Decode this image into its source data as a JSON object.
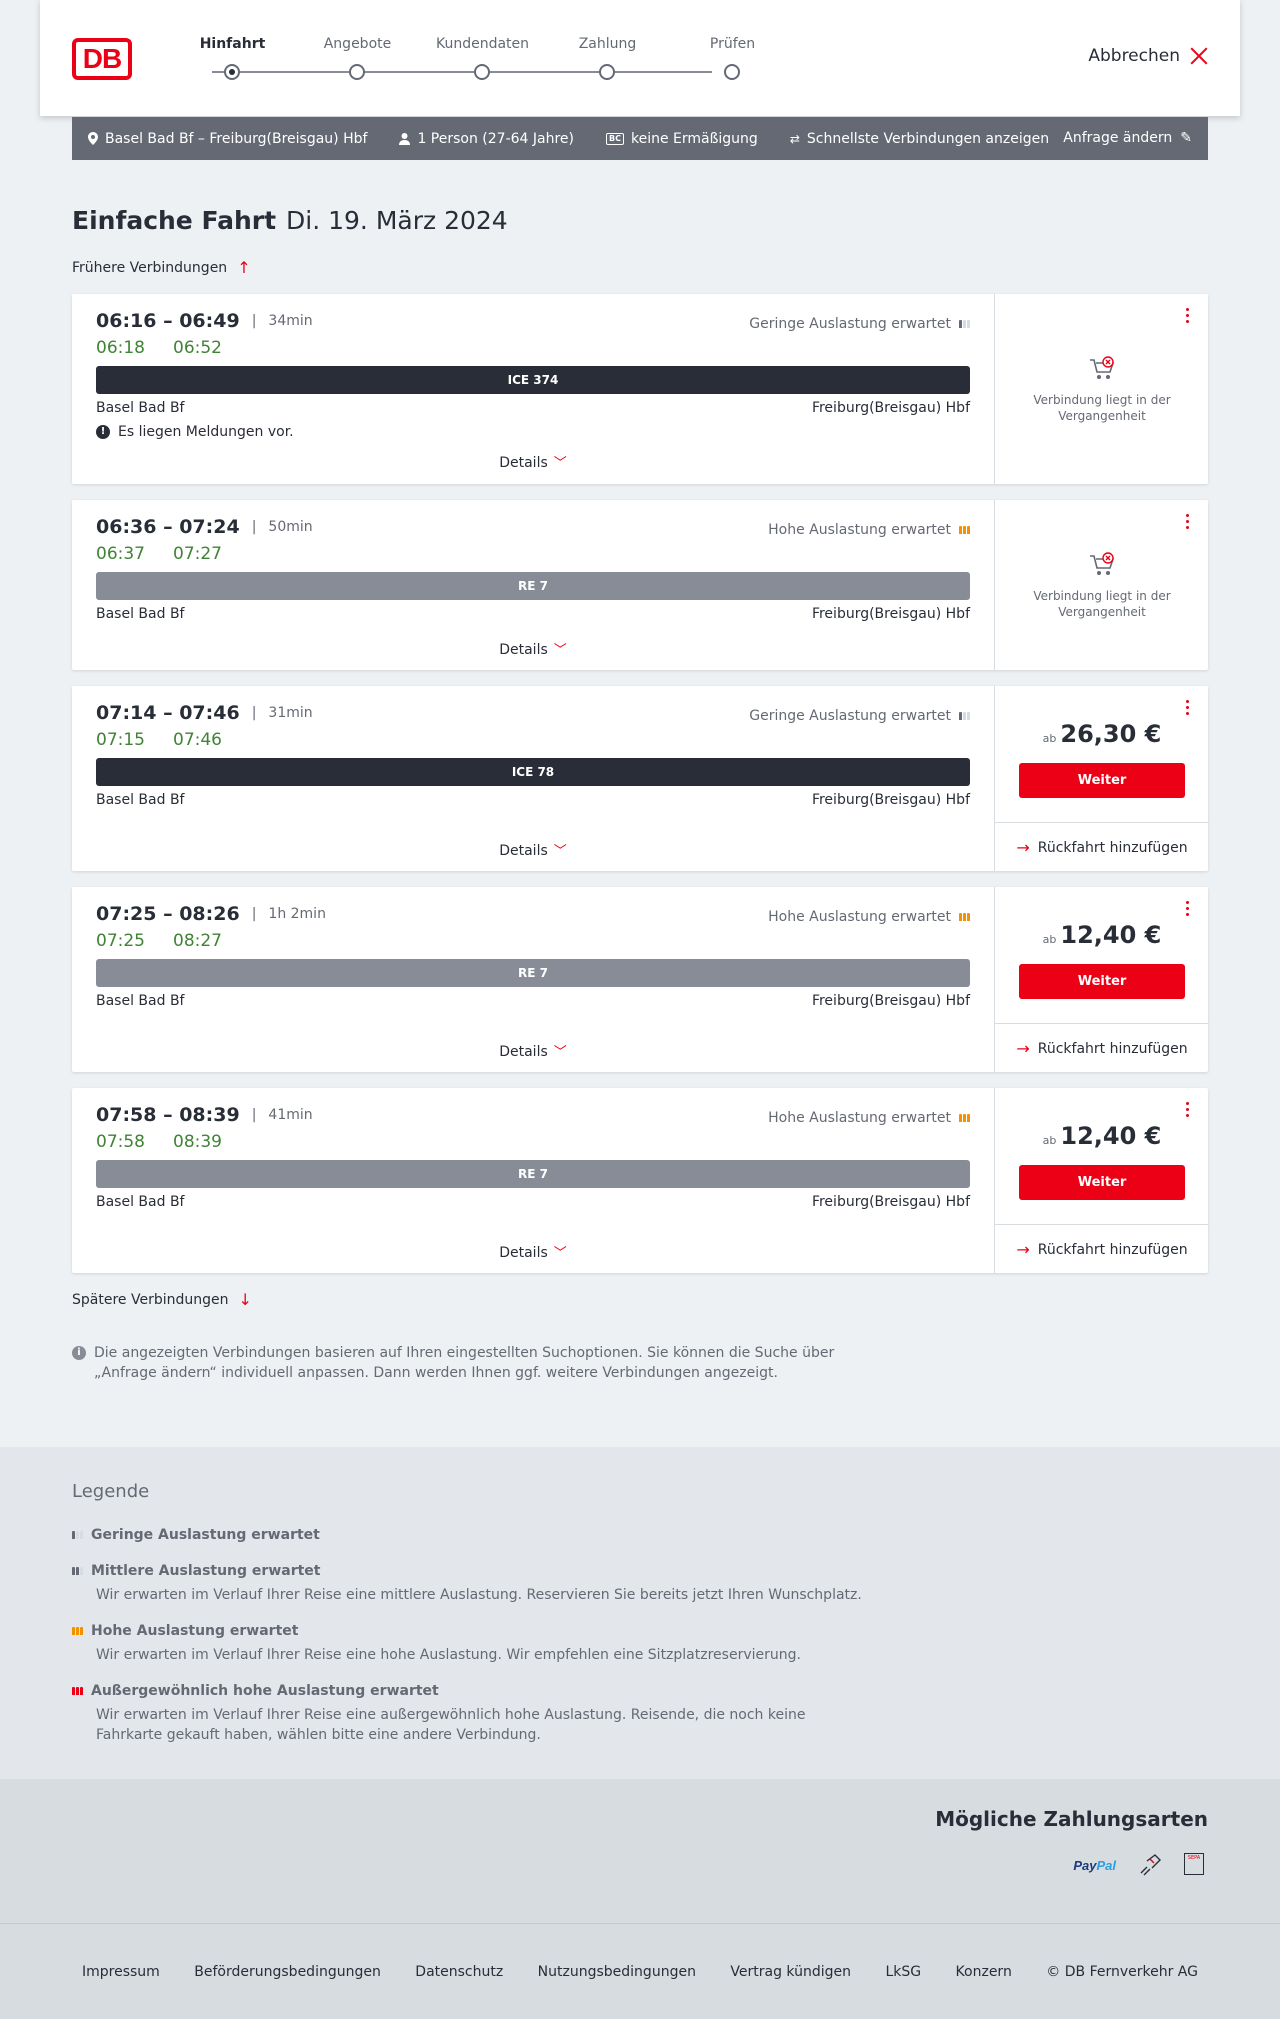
{
  "header": {
    "logo": "DB",
    "steps": [
      {
        "label": "Hinfahrt",
        "active": true
      },
      {
        "label": "Angebote",
        "active": false
      },
      {
        "label": "Kundendaten",
        "active": false
      },
      {
        "label": "Zahlung",
        "active": false
      },
      {
        "label": "Prüfen",
        "active": false
      }
    ],
    "cancel_label": "Abbrechen"
  },
  "query": {
    "route": "Basel Bad Bf – Freiburg(Breisgau) Hbf",
    "persons": "1 Person (27-64 Jahre)",
    "discount_badge": "BC",
    "discount": "keine Ermäßigung",
    "fastest": "Schnellste Verbindungen anzeigen",
    "change": "Anfrage ändern"
  },
  "page": {
    "title": "Einfache Fahrt",
    "date": "Di. 19. März 2024",
    "earlier": "Frühere Verbindungen",
    "later": "Spätere Verbindungen",
    "details_label": "Details",
    "info": "Die angezeigten Verbindungen basieren auf Ihren eingestellten Suchoptionen. Sie können die Suche über „Anfrage ändern“ individuell anpassen. Dann werden Ihnen ggf. weitere Verbindungen angezeigt."
  },
  "connections": [
    {
      "time": "06:16 – 06:49",
      "duration": "34min",
      "rt_dep": "06:18",
      "rt_arr": "06:52",
      "load": "Geringe Auslastung erwartet",
      "load_level": "low",
      "train": "ICE 374",
      "train_type": "ice",
      "from": "Basel Bad Bf",
      "to": "Freiburg(Breisgau) Hbf",
      "message": "Es liegen Meldungen vor.",
      "status": "Verbindung liegt in der Vergangenheit"
    },
    {
      "time": "06:36 – 07:24",
      "duration": "50min",
      "rt_dep": "06:37",
      "rt_arr": "07:27",
      "load": "Hohe Auslastung erwartet",
      "load_level": "high",
      "train": "RE 7",
      "train_type": "re",
      "from": "Basel Bad Bf",
      "to": "Freiburg(Breisgau) Hbf",
      "status": "Verbindung liegt in der Vergangenheit"
    },
    {
      "time": "07:14 – 07:46",
      "duration": "31min",
      "rt_dep": "07:15",
      "rt_arr": "07:46",
      "load": "Geringe Auslastung erwartet",
      "load_level": "low",
      "train": "ICE 78",
      "train_type": "ice",
      "from": "Basel Bad Bf",
      "to": "Freiburg(Breisgau) Hbf",
      "price_prefix": "ab",
      "price": "26,30 €",
      "button": "Weiter",
      "return": "Rückfahrt hinzufügen"
    },
    {
      "time": "07:25 – 08:26",
      "duration": "1h 2min",
      "rt_dep": "07:25",
      "rt_arr": "08:27",
      "load": "Hohe Auslastung erwartet",
      "load_level": "high",
      "train": "RE 7",
      "train_type": "re",
      "from": "Basel Bad Bf",
      "to": "Freiburg(Breisgau) Hbf",
      "price_prefix": "ab",
      "price": "12,40 €",
      "button": "Weiter",
      "return": "Rückfahrt hinzufügen"
    },
    {
      "time": "07:58 – 08:39",
      "duration": "41min",
      "rt_dep": "07:58",
      "rt_arr": "08:39",
      "load": "Hohe Auslastung erwartet",
      "load_level": "high",
      "train": "RE 7",
      "train_type": "re",
      "from": "Basel Bad Bf",
      "to": "Freiburg(Breisgau) Hbf",
      "price_prefix": "ab",
      "price": "12,40 €",
      "button": "Weiter",
      "return": "Rückfahrt hinzufügen"
    }
  ],
  "legend": {
    "title": "Legende",
    "items": [
      {
        "title": "Geringe Auslastung erwartet",
        "text": ""
      },
      {
        "title": "Mittlere Auslastung erwartet",
        "text": "Wir erwarten im Verlauf Ihrer Reise eine mittlere Auslastung. Reservieren Sie bereits jetzt Ihren Wunschplatz."
      },
      {
        "title": "Hohe Auslastung erwartet",
        "text": "Wir erwarten im Verlauf Ihrer Reise eine hohe Auslastung. Wir empfehlen eine Sitzplatzreservierung."
      },
      {
        "title": "Außergewöhnlich hohe Auslastung erwartet",
        "text": "Wir erwarten im Verlauf Ihrer Reise eine außergewöhnlich hohe Auslastung. Reisende, die noch keine Fahrkarte gekauft haben, wählen bitte eine andere Verbindung."
      }
    ]
  },
  "payment": {
    "title": "Mögliche Zahlungsarten",
    "paypal_a": "Pay",
    "paypal_b": "Pal",
    "sepa": "SEPA"
  },
  "footer": [
    "Impressum",
    "Beförderungsbedingungen",
    "Datenschutz",
    "Nutzungsbedingungen",
    "Vertrag kündigen",
    "LkSG",
    "Konzern",
    "© DB Fernverkehr AG"
  ],
  "colors": {
    "brand_red": "#ec0016",
    "realtime_green": "#408335",
    "load_high": "#f39200"
  }
}
